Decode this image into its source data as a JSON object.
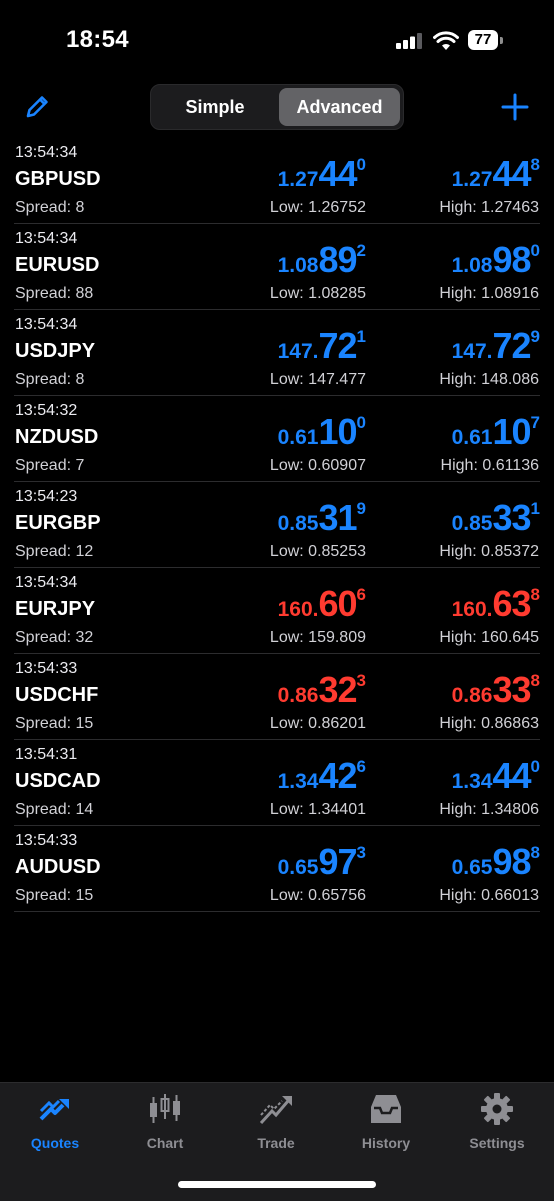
{
  "status_bar": {
    "time": "18:54",
    "battery": "77"
  },
  "toolbar": {
    "simple_label": "Simple",
    "advanced_label": "Advanced"
  },
  "colors": {
    "blue": "#1a84ff",
    "red": "#ff3b30",
    "active_tab": "#1a84ff"
  },
  "quotes": [
    {
      "time": "13:54:34",
      "symbol": "GBPUSD",
      "spread": "Spread: 8",
      "bid": {
        "a": "1.27",
        "b": "44",
        "c": "0"
      },
      "ask": {
        "a": "1.27",
        "b": "44",
        "c": "8"
      },
      "low": "Low: 1.26752",
      "high": "High: 1.27463",
      "color": "blue"
    },
    {
      "time": "13:54:34",
      "symbol": "EURUSD",
      "spread": "Spread: 88",
      "bid": {
        "a": "1.08",
        "b": "89",
        "c": "2"
      },
      "ask": {
        "a": "1.08",
        "b": "98",
        "c": "0"
      },
      "low": "Low: 1.08285",
      "high": "High: 1.08916",
      "color": "blue"
    },
    {
      "time": "13:54:34",
      "symbol": "USDJPY",
      "spread": "Spread: 8",
      "bid": {
        "a": "147.",
        "b": "72",
        "c": "1"
      },
      "ask": {
        "a": "147.",
        "b": "72",
        "c": "9"
      },
      "low": "Low: 147.477",
      "high": "High: 148.086",
      "color": "blue"
    },
    {
      "time": "13:54:32",
      "symbol": "NZDUSD",
      "spread": "Spread: 7",
      "bid": {
        "a": "0.61",
        "b": "10",
        "c": "0"
      },
      "ask": {
        "a": "0.61",
        "b": "10",
        "c": "7"
      },
      "low": "Low: 0.60907",
      "high": "High: 0.61136",
      "color": "blue"
    },
    {
      "time": "13:54:23",
      "symbol": "EURGBP",
      "spread": "Spread: 12",
      "bid": {
        "a": "0.85",
        "b": "31",
        "c": "9"
      },
      "ask": {
        "a": "0.85",
        "b": "33",
        "c": "1"
      },
      "low": "Low: 0.85253",
      "high": "High: 0.85372",
      "color": "blue"
    },
    {
      "time": "13:54:34",
      "symbol": "EURJPY",
      "spread": "Spread: 32",
      "bid": {
        "a": "160.",
        "b": "60",
        "c": "6"
      },
      "ask": {
        "a": "160.",
        "b": "63",
        "c": "8"
      },
      "low": "Low: 159.809",
      "high": "High: 160.645",
      "color": "red"
    },
    {
      "time": "13:54:33",
      "symbol": "USDCHF",
      "spread": "Spread: 15",
      "bid": {
        "a": "0.86",
        "b": "32",
        "c": "3"
      },
      "ask": {
        "a": "0.86",
        "b": "33",
        "c": "8"
      },
      "low": "Low: 0.86201",
      "high": "High: 0.86863",
      "color": "red"
    },
    {
      "time": "13:54:31",
      "symbol": "USDCAD",
      "spread": "Spread: 14",
      "bid": {
        "a": "1.34",
        "b": "42",
        "c": "6"
      },
      "ask": {
        "a": "1.34",
        "b": "44",
        "c": "0"
      },
      "low": "Low: 1.34401",
      "high": "High: 1.34806",
      "color": "blue"
    },
    {
      "time": "13:54:33",
      "symbol": "AUDUSD",
      "spread": "Spread: 15",
      "bid": {
        "a": "0.65",
        "b": "97",
        "c": "3"
      },
      "ask": {
        "a": "0.65",
        "b": "98",
        "c": "8"
      },
      "low": "Low: 0.65756",
      "high": "High: 0.66013",
      "color": "blue"
    }
  ],
  "tabs": [
    {
      "label": "Quotes",
      "icon": "quotes-icon",
      "active": true
    },
    {
      "label": "Chart",
      "icon": "chart-icon",
      "active": false
    },
    {
      "label": "Trade",
      "icon": "trade-icon",
      "active": false
    },
    {
      "label": "History",
      "icon": "history-icon",
      "active": false
    },
    {
      "label": "Settings",
      "icon": "settings-icon",
      "active": false
    }
  ]
}
